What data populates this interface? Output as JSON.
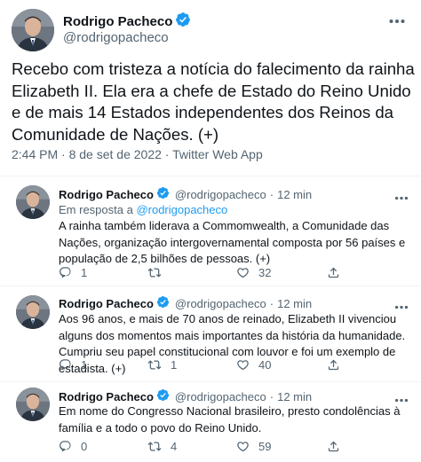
{
  "main_tweet": {
    "author_name": "Rodrigo Pacheco",
    "author_handle": "@rodrigopacheco",
    "text": "Recebo com tristeza a notícia do falecimento da rainha Elizabeth II. Ela era a chefe de Estado do Reino Unido e de mais 14 Estados independentes dos Reinos da Comunidade de Nações. (+)",
    "timestamp": "2:44 PM · 8 de set de 2022 · Twitter Web App"
  },
  "replies": [
    {
      "author_name": "Rodrigo Pacheco",
      "author_handle": "@rodrigopacheco",
      "time": "12 min",
      "in_reply_prefix": "Em resposta a ",
      "in_reply_handle": "@rodrigopacheco",
      "text": "A rainha também liderava a Commomwealth, a Comunidade das Nações, organização intergovernamental composta por 56 países e população de 2,5 bilhões de pessoas. (+)",
      "reply_count": "1",
      "retweet_count": "",
      "like_count": "32"
    },
    {
      "author_name": "Rodrigo Pacheco",
      "author_handle": "@rodrigopacheco",
      "time": "12 min",
      "text": "Aos 96 anos, e mais de 70 anos de reinado, Elizabeth II vivenciou alguns dos momentos mais importantes da história da humanidade. Cumpriu seu papel constitucional com louvor e foi um exemplo de estadista. (+)",
      "reply_count": "1",
      "retweet_count": "1",
      "like_count": "40"
    },
    {
      "author_name": "Rodrigo Pacheco",
      "author_handle": "@rodrigopacheco",
      "time": "12 min",
      "text": "Em nome do Congresso Nacional brasileiro, presto condolências à família e a todo o povo do Reino Unido.",
      "reply_count": "0",
      "retweet_count": "4",
      "like_count": "59"
    }
  ],
  "colors": {
    "verified": "#1d9bf0",
    "secondary_text": "#536471",
    "link": "#1d9bf0"
  },
  "icons": [
    "verified-badge-icon",
    "more-options-icon",
    "reply-icon",
    "retweet-icon",
    "like-icon",
    "share-icon"
  ]
}
